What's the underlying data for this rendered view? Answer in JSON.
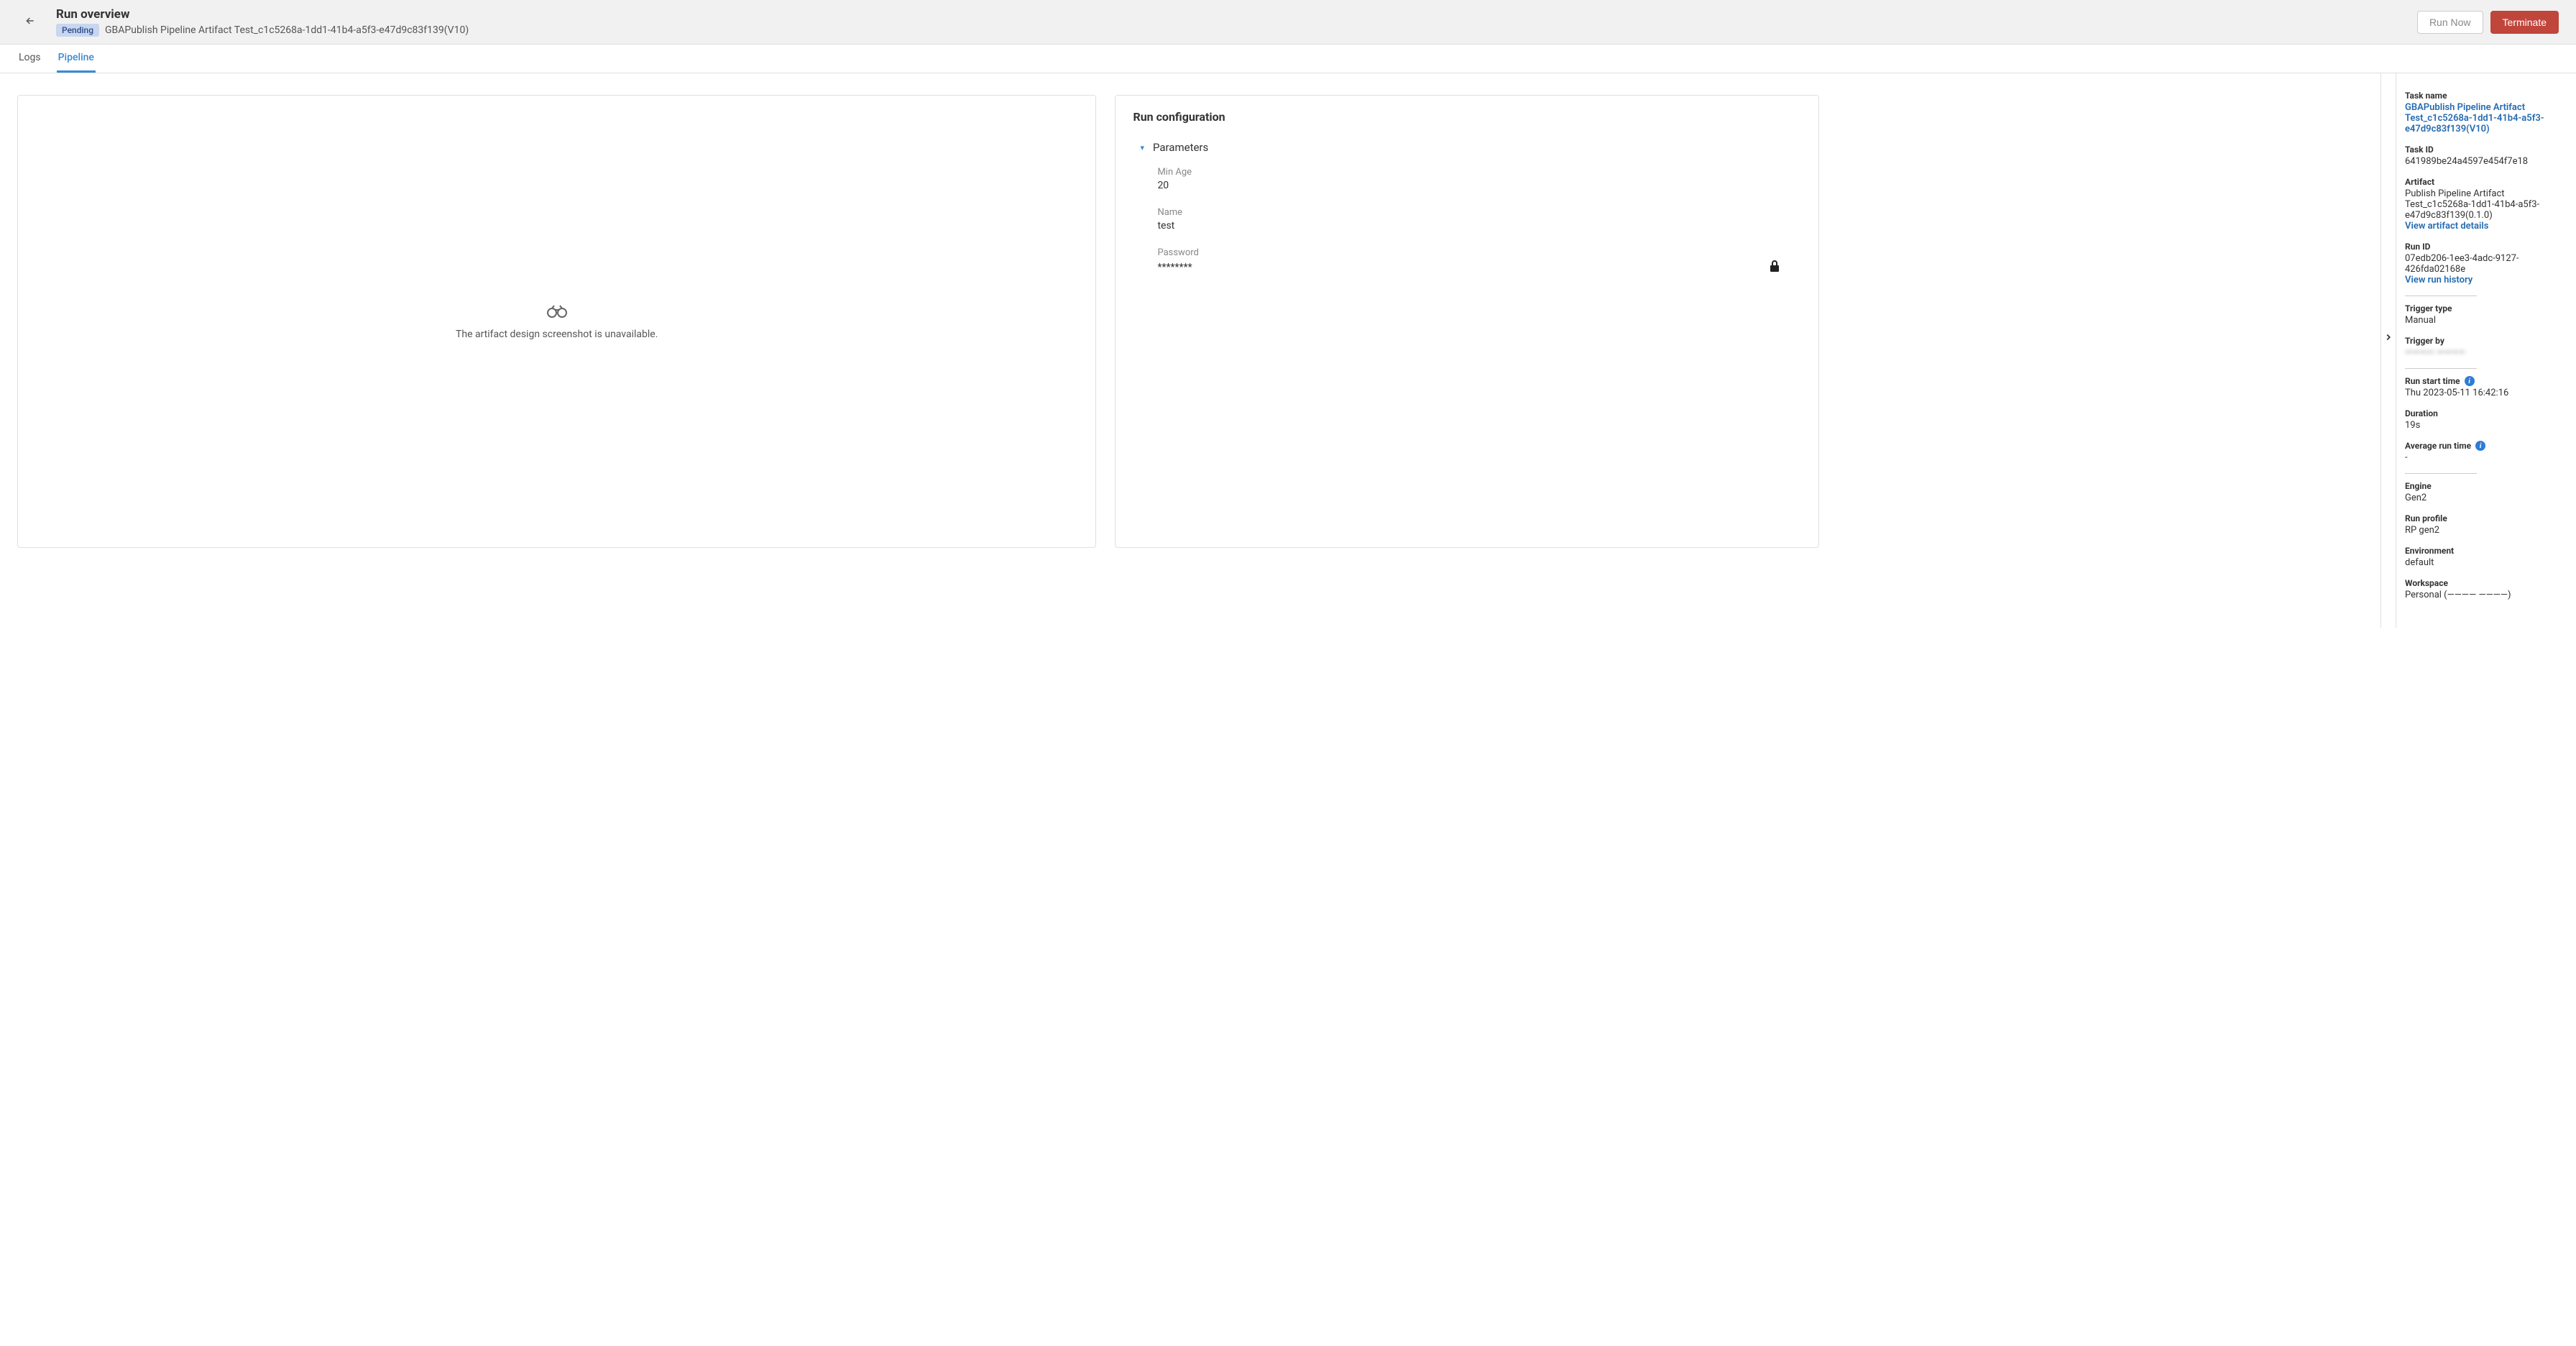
{
  "header": {
    "title": "Run overview",
    "status_badge": "Pending",
    "subtitle": "GBAPublish Pipeline Artifact Test_c1c5268a-1dd1-41b4-a5f3-e47d9c83f139(V10)",
    "run_now": "Run Now",
    "terminate": "Terminate"
  },
  "tabs": {
    "logs": "Logs",
    "pipeline": "Pipeline"
  },
  "artifact_panel": {
    "empty": "The artifact design screenshot is unavailable."
  },
  "config": {
    "title": "Run configuration",
    "section": "Parameters",
    "min_age_label": "Min Age",
    "min_age_value": "20",
    "name_label": "Name",
    "name_value": "test",
    "password_label": "Password",
    "password_value": "********"
  },
  "side": {
    "task_name_label": "Task name",
    "task_name": "GBAPublish Pipeline Artifact Test_c1c5268a-1dd1-41b4-a5f3-e47d9c83f139(V10)",
    "task_id_label": "Task ID",
    "task_id": "641989be24a4597e454f7e18",
    "artifact_label": "Artifact",
    "artifact": "Publish Pipeline Artifact Test_c1c5268a-1dd1-41b4-a5f3-e47d9c83f139(0.1.0)",
    "artifact_link": "View artifact details",
    "run_id_label": "Run ID",
    "run_id": "07edb206-1ee3-4adc-9127-426fda02168e",
    "run_history_link": "View run history",
    "trigger_type_label": "Trigger type",
    "trigger_type": "Manual",
    "trigger_by_label": "Trigger by",
    "trigger_by": "———— ————",
    "run_start_label": "Run start time",
    "run_start": "Thu 2023-05-11 16:42:16",
    "duration_label": "Duration",
    "duration": "19s",
    "avg_label": "Average run time",
    "avg": "-",
    "engine_label": "Engine",
    "engine": "Gen2",
    "profile_label": "Run profile",
    "profile": "RP gen2",
    "env_label": "Environment",
    "env": "default",
    "ws_label": "Workspace",
    "ws": "Personal (———— ————)"
  }
}
